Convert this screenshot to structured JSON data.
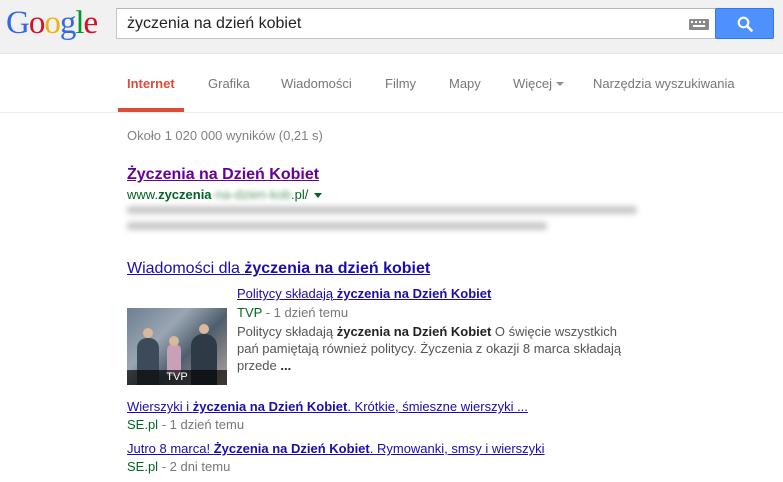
{
  "header": {
    "logo_letters": [
      {
        "ch": "G",
        "color": "#3369e8"
      },
      {
        "ch": "o",
        "color": "#d50f25"
      },
      {
        "ch": "o",
        "color": "#eeb211"
      },
      {
        "ch": "g",
        "color": "#3369e8"
      },
      {
        "ch": "l",
        "color": "#009925"
      },
      {
        "ch": "e",
        "color": "#d50f25"
      }
    ],
    "search_query": "życzenia na dzień kobiet",
    "keyboard_icon": "keyboard-icon",
    "search_icon": "magnifier-icon"
  },
  "tabs": {
    "internet": "Internet",
    "grafika": "Grafika",
    "wiadomosci": "Wiadomości",
    "filmy": "Filmy",
    "mapy": "Mapy",
    "wiecej": "Więcej",
    "narzedzia": "Narzędzia wyszukiwania"
  },
  "results": {
    "stats": "Około 1 020 000 wyników (0,21 s)",
    "first": {
      "title": "Życzenia na Dzień Kobiet",
      "url_prefix": "www.",
      "url_bold": "zyczenia",
      "url_suffix": ".pl/"
    },
    "news": {
      "header_prefix": "Wiadomości dla ",
      "header_bold": "życzenia na dzień kobiet",
      "thumb_label": "TVP",
      "main": {
        "title_prefix": "Politycy składają ",
        "title_bold": "życzenia na Dzień Kobiet",
        "source": "TVP",
        "time": " - 1 dzień temu",
        "snippet_prefix": "Politycy składają ",
        "snippet_bold": "życzenia na Dzień Kobiet",
        "snippet_rest": " O święcie wszystkich pań pamiętają również politycy. Życzenia z okazji 8 marca składają przede ",
        "snippet_ellipsis": "..."
      },
      "items": [
        {
          "title_prefix": "Wierszyki i ",
          "title_bold": "życzenia na Dzień Kobiet",
          "title_rest": ". Krótkie, śmieszne wierszyki ...",
          "source": "SE.pl",
          "time": " - 1 dzień temu"
        },
        {
          "title_prefix": "Jutro 8 marca! ",
          "title_bold": "Życzenia na Dzień Kobiet",
          "title_rest": ". Rymowanki, smsy i wierszyki",
          "source": "SE.pl",
          "time": " - 2 dni temu"
        }
      ]
    }
  }
}
